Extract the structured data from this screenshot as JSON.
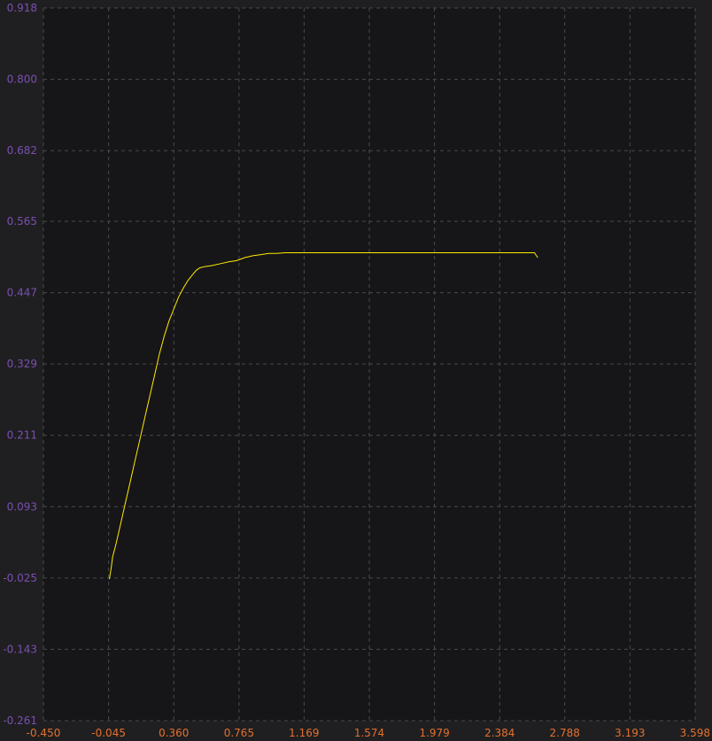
{
  "chart_data": {
    "type": "line",
    "title": "",
    "xlabel": "",
    "ylabel": "",
    "xlim": [
      -0.45,
      3.598
    ],
    "ylim": [
      -0.261,
      0.918
    ],
    "x_ticks": [
      "-0.450",
      "-0.045",
      "0.360",
      "0.765",
      "1.169",
      "1.574",
      "1.979",
      "2.384",
      "2.788",
      "3.193",
      "3.598"
    ],
    "y_ticks": [
      "0.918",
      "0.800",
      "0.682",
      "0.565",
      "0.447",
      "0.329",
      "0.211",
      "0.093",
      "-0.025",
      "-0.143",
      "-0.261"
    ],
    "grid": true,
    "colors": {
      "background": "#1f1f21",
      "plot_area": "#161619",
      "grid": "#4a4a4f",
      "series": "#ffea00",
      "y_tick_text": "#7b4fb0",
      "x_tick_text": "#e3702d"
    },
    "series": [
      {
        "name": "",
        "x": [
          -0.04,
          -0.03,
          -0.02,
          0.0,
          0.03,
          0.06,
          0.09,
          0.12,
          0.15,
          0.18,
          0.21,
          0.24,
          0.27,
          0.3,
          0.33,
          0.36,
          0.39,
          0.42,
          0.45,
          0.48,
          0.5,
          0.52,
          0.55,
          0.6,
          0.65,
          0.7,
          0.75,
          0.8,
          0.85,
          0.9,
          0.95,
          1.0,
          1.05,
          1.1,
          1.2,
          1.3,
          1.4,
          1.5,
          1.6,
          1.7,
          1.8,
          1.9,
          2.0,
          2.1,
          2.2,
          2.3,
          2.4,
          2.5,
          2.6,
          2.62
        ],
        "y": [
          -0.027,
          -0.01,
          0.01,
          0.03,
          0.065,
          0.1,
          0.135,
          0.17,
          0.205,
          0.24,
          0.275,
          0.31,
          0.345,
          0.375,
          0.4,
          0.42,
          0.44,
          0.455,
          0.468,
          0.478,
          0.484,
          0.488,
          0.49,
          0.492,
          0.495,
          0.498,
          0.5,
          0.505,
          0.508,
          0.51,
          0.512,
          0.512,
          0.513,
          0.513,
          0.513,
          0.513,
          0.513,
          0.513,
          0.513,
          0.513,
          0.513,
          0.513,
          0.513,
          0.513,
          0.513,
          0.513,
          0.513,
          0.513,
          0.513,
          0.505
        ]
      }
    ]
  }
}
